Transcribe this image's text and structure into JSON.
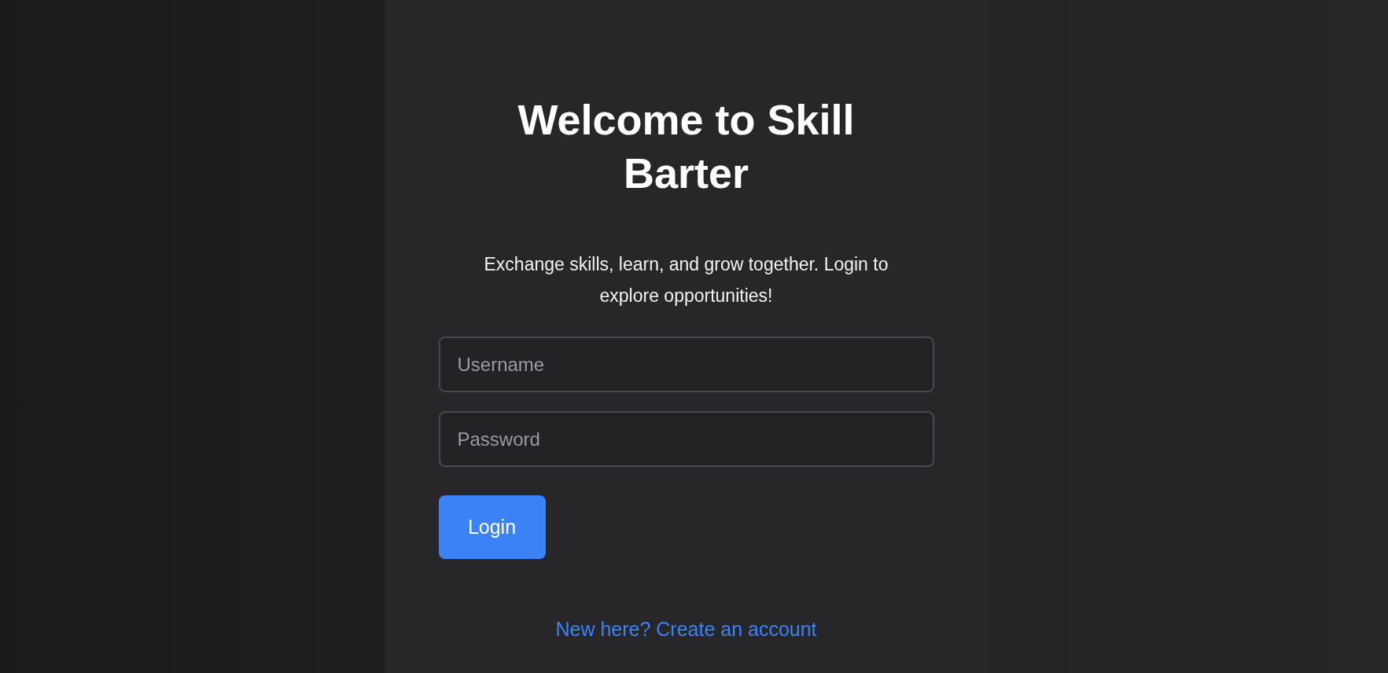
{
  "title": "Welcome to Skill Barter",
  "subtitle": "Exchange skills, learn, and grow together. Login to explore opportunities!",
  "fields": [
    {
      "placeholder": "Username"
    },
    {
      "placeholder": "Password"
    }
  ],
  "login_button": "Login",
  "signup_link": "New here? Create an account"
}
